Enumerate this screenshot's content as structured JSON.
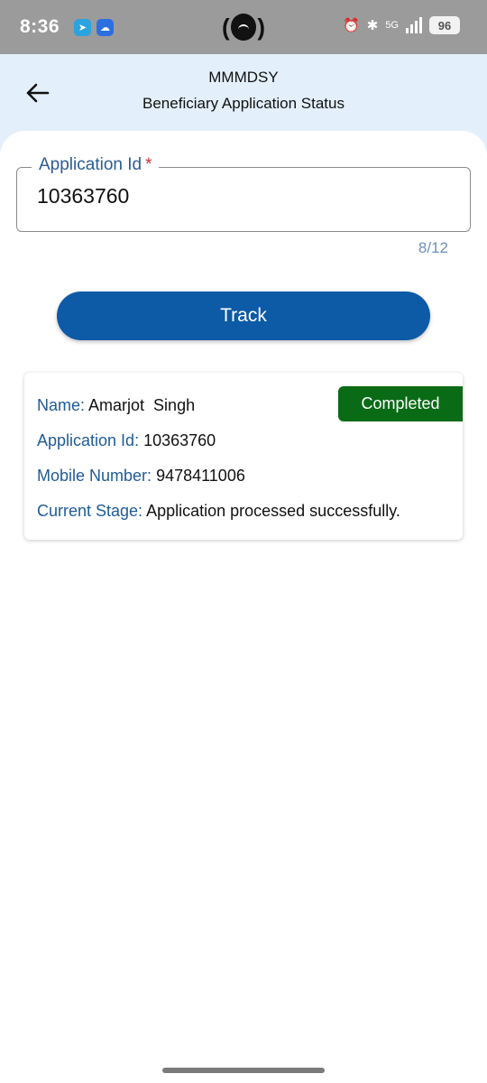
{
  "status_bar": {
    "time": "8:36",
    "network": "5G",
    "battery": "96"
  },
  "header": {
    "title": "MMMDSY",
    "subtitle": "Beneficiary Application Status"
  },
  "form": {
    "field_label": "Application Id",
    "required_mark": "*",
    "field_value": "10363760",
    "counter": "8/12",
    "track_label": "Track"
  },
  "result": {
    "status": "Completed",
    "status_color": "#0a6b16",
    "rows": [
      {
        "key": "Name:",
        "value": "Amarjot  Singh"
      },
      {
        "key": "Application Id:",
        "value": "10363760"
      },
      {
        "key": "Mobile Number:",
        "value": "9478411006"
      },
      {
        "key": "Current Stage:",
        "value": "Application processed successfully."
      }
    ]
  },
  "colors": {
    "accent": "#0d5aa6",
    "label": "#1f5b97",
    "header_bg": "#e3f0fb"
  }
}
